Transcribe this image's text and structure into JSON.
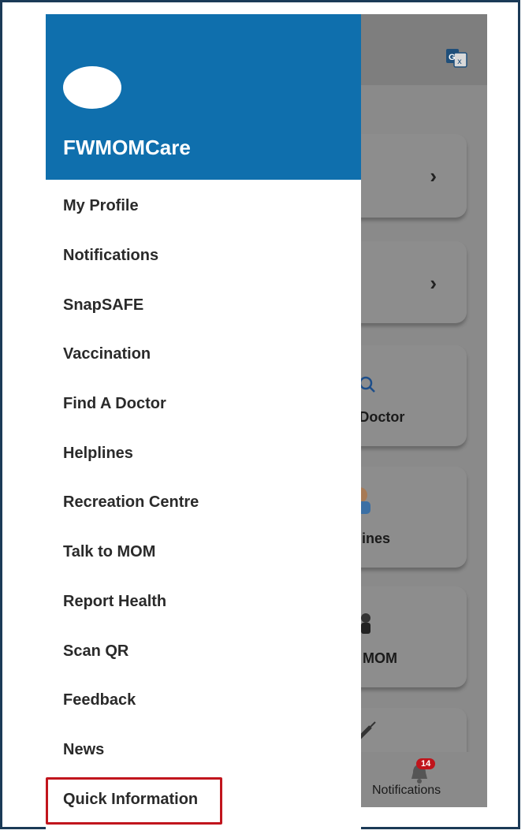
{
  "app": {
    "name": "FWMOMCare"
  },
  "drawer": {
    "items": [
      {
        "label": "My Profile"
      },
      {
        "label": "Notifications"
      },
      {
        "label": "SnapSAFE"
      },
      {
        "label": "Vaccination"
      },
      {
        "label": "Find A Doctor"
      },
      {
        "label": "Helplines"
      },
      {
        "label": "Recreation Centre"
      },
      {
        "label": "Talk to MOM"
      },
      {
        "label": "Report Health"
      },
      {
        "label": "Scan QR"
      },
      {
        "label": "Feedback"
      },
      {
        "label": "News"
      },
      {
        "label": "Quick Information"
      }
    ],
    "highlighted_item": "Quick Information"
  },
  "background": {
    "cards": [
      {
        "label": ""
      },
      {
        "label": ""
      },
      {
        "label": "A Doctor"
      },
      {
        "label": "lplines"
      },
      {
        "label": "to MOM"
      }
    ],
    "bottom_tab": {
      "label": "Notifications",
      "badge": "14"
    }
  },
  "colors": {
    "header_blue": "#0f6fad",
    "highlight_red": "#c1151d",
    "badge_red": "#c0141b",
    "frame": "#1b3a57"
  },
  "icons": [
    "translate-icon",
    "chevron-right-icon",
    "doctor-search-icon",
    "helpline-icon",
    "talk-icon",
    "syringe-icon",
    "bell-icon"
  ]
}
